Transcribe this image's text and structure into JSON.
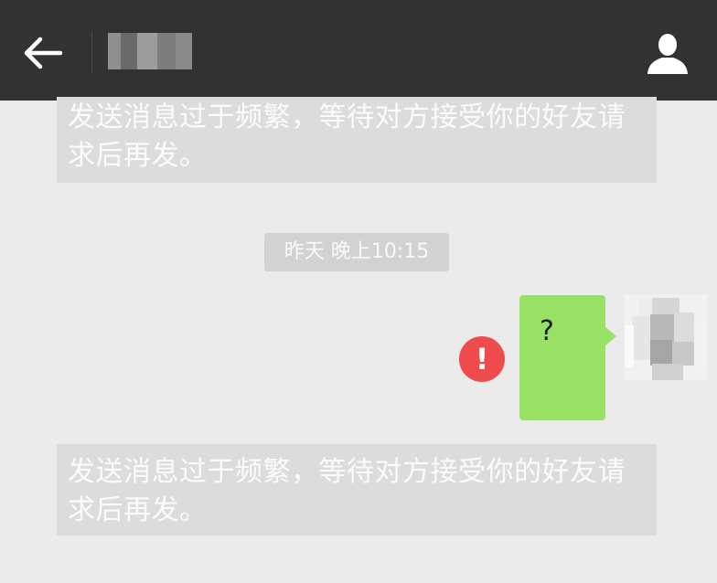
{
  "header": {
    "back_icon": "arrow-left-icon",
    "contact_name_redacted": true,
    "profile_icon": "person-icon"
  },
  "chat": {
    "system_notice_1": "发送消息过于频繁，等待对方接受你的好友请求后再发。",
    "timestamp": "昨天 晚上10:15",
    "message": {
      "text": "?",
      "status_icon": "error-icon",
      "status_glyph": "!",
      "avatar_redacted": true
    },
    "system_notice_2": "发送消息过于频繁，等待对方接受你的好友请求后再发。"
  },
  "colors": {
    "topbar": "#323232",
    "background": "#ebebeb",
    "notice_bg": "#dcdcdc",
    "timestamp_bg": "#d2d2d2",
    "bubble": "#98e165",
    "error": "#ef4a4c"
  }
}
